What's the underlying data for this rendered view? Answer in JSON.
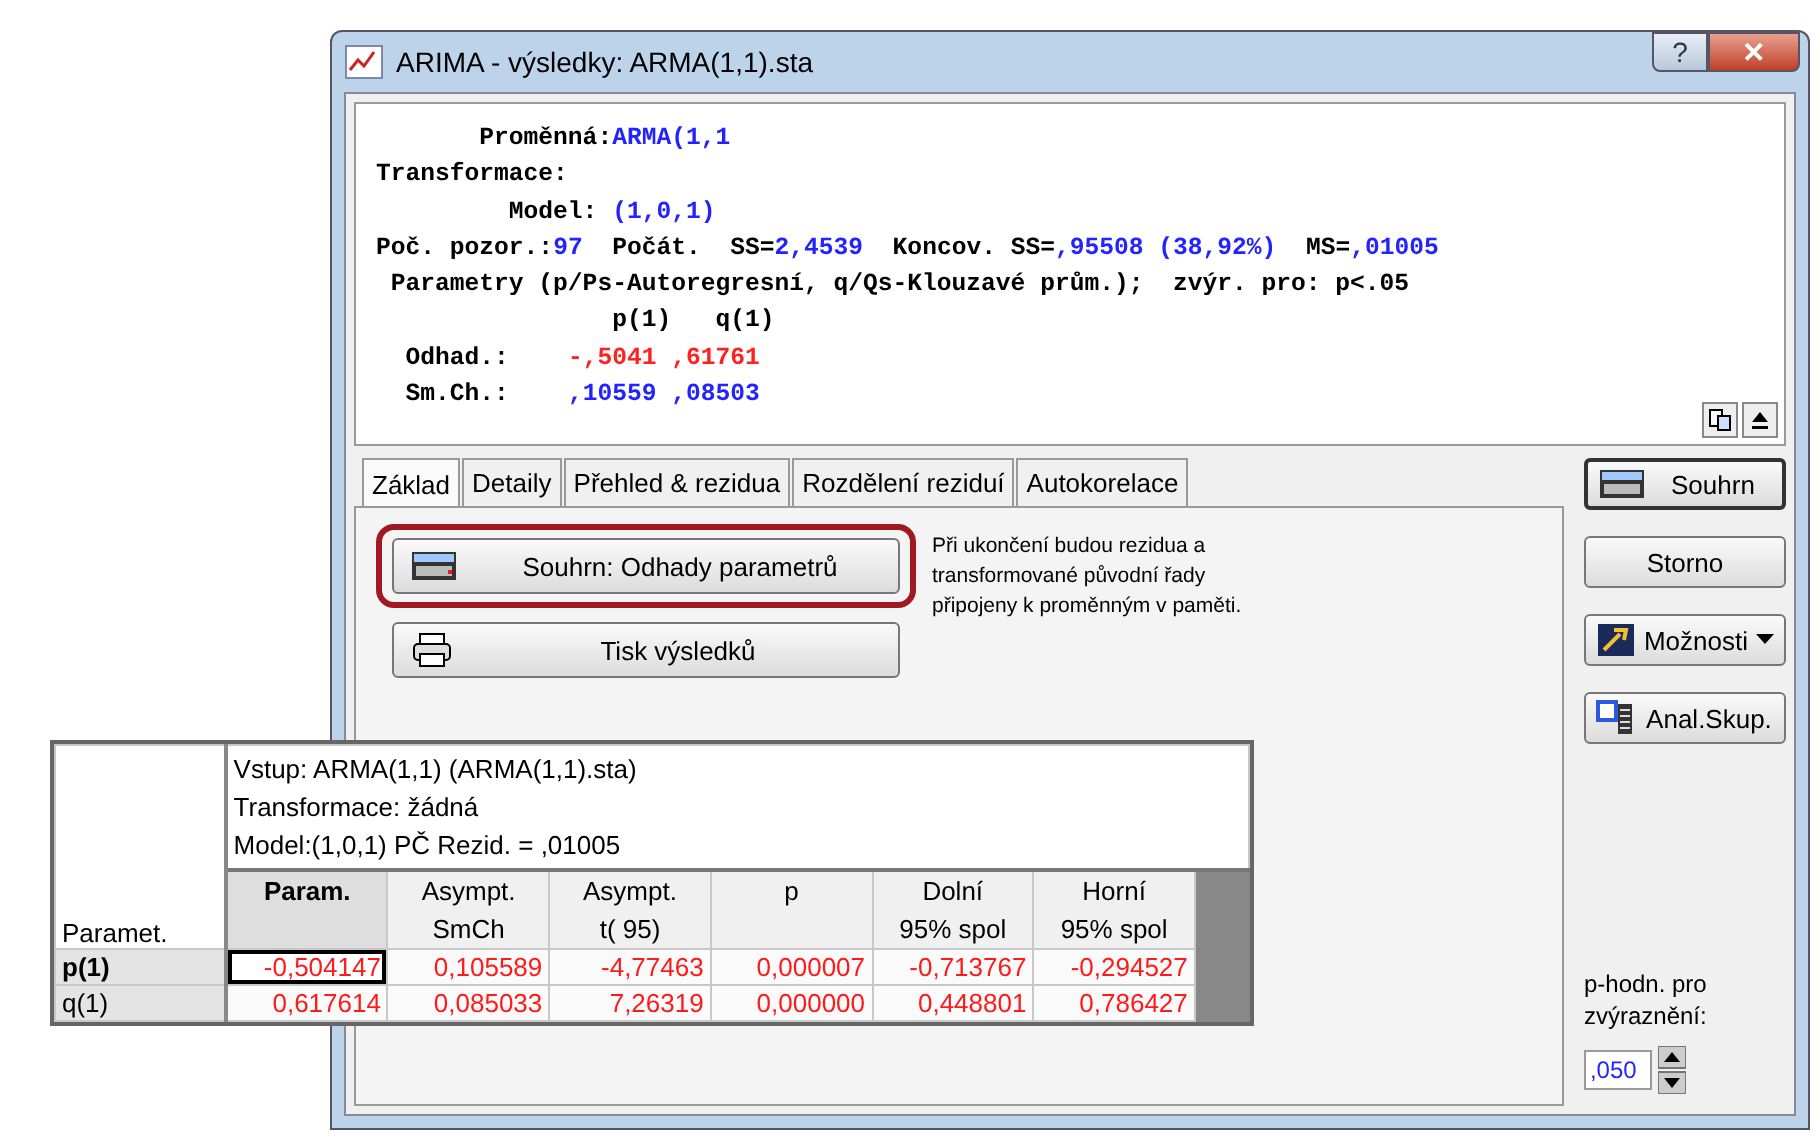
{
  "window": {
    "title": "ARIMA - výsledky: ARMA(1,1).sta",
    "help_button": "?",
    "close_button": "✕"
  },
  "output": {
    "lines": [
      {
        "segments": [
          {
            "kind": "label",
            "text": "       Proměnná:"
          },
          {
            "kind": "value",
            "text": "ARMA(1,1"
          }
        ]
      },
      {
        "segments": [
          {
            "kind": "label",
            "text": "Transformace:"
          }
        ]
      },
      {
        "segments": [
          {
            "kind": "label",
            "text": "         Model: "
          },
          {
            "kind": "value",
            "text": "(1,0,1)"
          }
        ]
      },
      {
        "segments": [
          {
            "kind": "label",
            "text": "Poč. pozor.:"
          },
          {
            "kind": "value",
            "text": "97"
          },
          {
            "kind": "label",
            "text": "  Počát.  SS="
          },
          {
            "kind": "value",
            "text": "2,4539"
          },
          {
            "kind": "label",
            "text": "  Koncov. SS="
          },
          {
            "kind": "value",
            "text": ",95508 (38,92%)"
          },
          {
            "kind": "label",
            "text": "  MS="
          },
          {
            "kind": "value",
            "text": ",01005"
          }
        ]
      },
      {
        "segments": [
          {
            "kind": "label",
            "text": " Parametry (p/Ps-Autoregresní, q/Qs-Klouzavé prům.);  zvýr. pro: p<.05"
          }
        ]
      },
      {
        "segments": [
          {
            "kind": "label",
            "text": "                p(1)   q(1)"
          }
        ]
      },
      {
        "segments": [
          {
            "kind": "label",
            "text": "  Odhad.:    "
          },
          {
            "kind": "significant",
            "text": "-,5041 ,61761"
          }
        ]
      },
      {
        "segments": [
          {
            "kind": "label",
            "text": "  Sm.Ch.:    "
          },
          {
            "kind": "value",
            "text": ",10559 ,08503"
          }
        ]
      }
    ]
  },
  "tabs": [
    {
      "label": "Základ",
      "selected": true
    },
    {
      "label": "Detaily",
      "selected": false
    },
    {
      "label": "Přehled & rezidua",
      "selected": false
    },
    {
      "label": "Rozdělení reziduí",
      "selected": false
    },
    {
      "label": "Autokorelace",
      "selected": false
    }
  ],
  "tab_buttons": [
    {
      "kind": "summary",
      "label": "Souhrn:  Odhady parametrů",
      "highlighted": true
    },
    {
      "kind": "print",
      "label": "Tisk výsledků",
      "highlighted": false
    }
  ],
  "note": "Při ukončení budou rezidua a transformované původní řady připojeny k proměnným v paměti.",
  "side_buttons": [
    {
      "kind": "summary",
      "label": "Souhrn",
      "default": true
    },
    {
      "kind": "plain",
      "label": "Storno",
      "default": false
    },
    {
      "kind": "options",
      "label": "Možnosti",
      "default": false
    },
    {
      "kind": "group",
      "label": "Anal.Skup.",
      "default": false
    }
  ],
  "p_value": {
    "label": "p-hodn. pro zvýraznění:",
    "value": ",050"
  },
  "spreadsheet": {
    "info_lines": [
      "Vstup: ARMA(1,1) (ARMA(1,1).sta)",
      "Transformace: žádná",
      "Model:(1,0,1) PČ Rezid. = ,01005"
    ],
    "row_header_title": "Paramet.",
    "columns": [
      {
        "line1": "Param."
      },
      {
        "line1": "Asympt.",
        "line2": "SmCh"
      },
      {
        "line1": "Asympt.",
        "line2": "t(   95)"
      },
      {
        "line1": "p"
      },
      {
        "line1": "Dolní",
        "line2": "95% spol"
      },
      {
        "line1": "Horní",
        "line2": "95% spol"
      }
    ],
    "rows": [
      {
        "label": "p(1)",
        "selected": true,
        "significant": true,
        "cells": [
          "-0,504147",
          "0,105589",
          "-4,77463",
          "0,000007",
          "-0,713767",
          "-0,294527"
        ]
      },
      {
        "label": "q(1)",
        "selected": false,
        "significant": true,
        "cells": [
          "0,617614",
          "0,085033",
          "7,26319",
          "0,000000",
          "0,448801",
          "0,786427"
        ]
      }
    ]
  }
}
